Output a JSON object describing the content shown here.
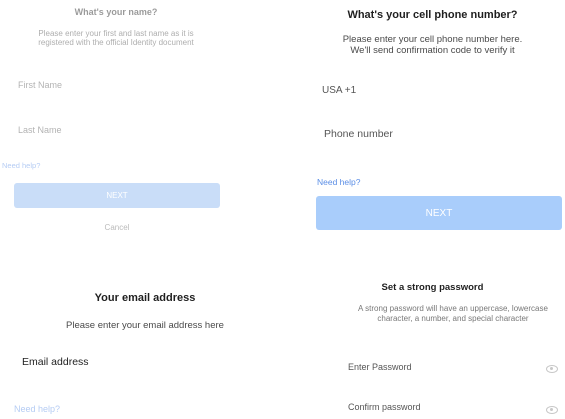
{
  "name_step": {
    "title": "What's your name?",
    "description": "Please enter your first and last name as it is registered with the official Identity document",
    "first_name_placeholder": "First Name",
    "last_name_placeholder": "Last Name",
    "help": "Need help?",
    "next": "NEXT",
    "cancel": "Cancel"
  },
  "phone_step": {
    "title": "What's your cell phone number?",
    "description_1": "Please enter your cell phone number here.",
    "description_2": "We'll send confirmation code to verify it",
    "country_code": "USA +1",
    "phone_placeholder": "Phone number",
    "help": "Need help?",
    "next": "NEXT"
  },
  "email_step": {
    "title": "Your email address",
    "description": "Please enter your email address here",
    "email_placeholder": "Email address",
    "help": "Need help?"
  },
  "password_step": {
    "title": "Set a strong password",
    "description": "A strong password will have an uppercase, lowercase character, a number, and special character",
    "password_placeholder": "Enter Password",
    "confirm_placeholder": "Confirm password"
  },
  "colors": {
    "accent": "#5b8ee6",
    "button": "#a9cdfb",
    "button_faint": "#c9ddf8"
  }
}
